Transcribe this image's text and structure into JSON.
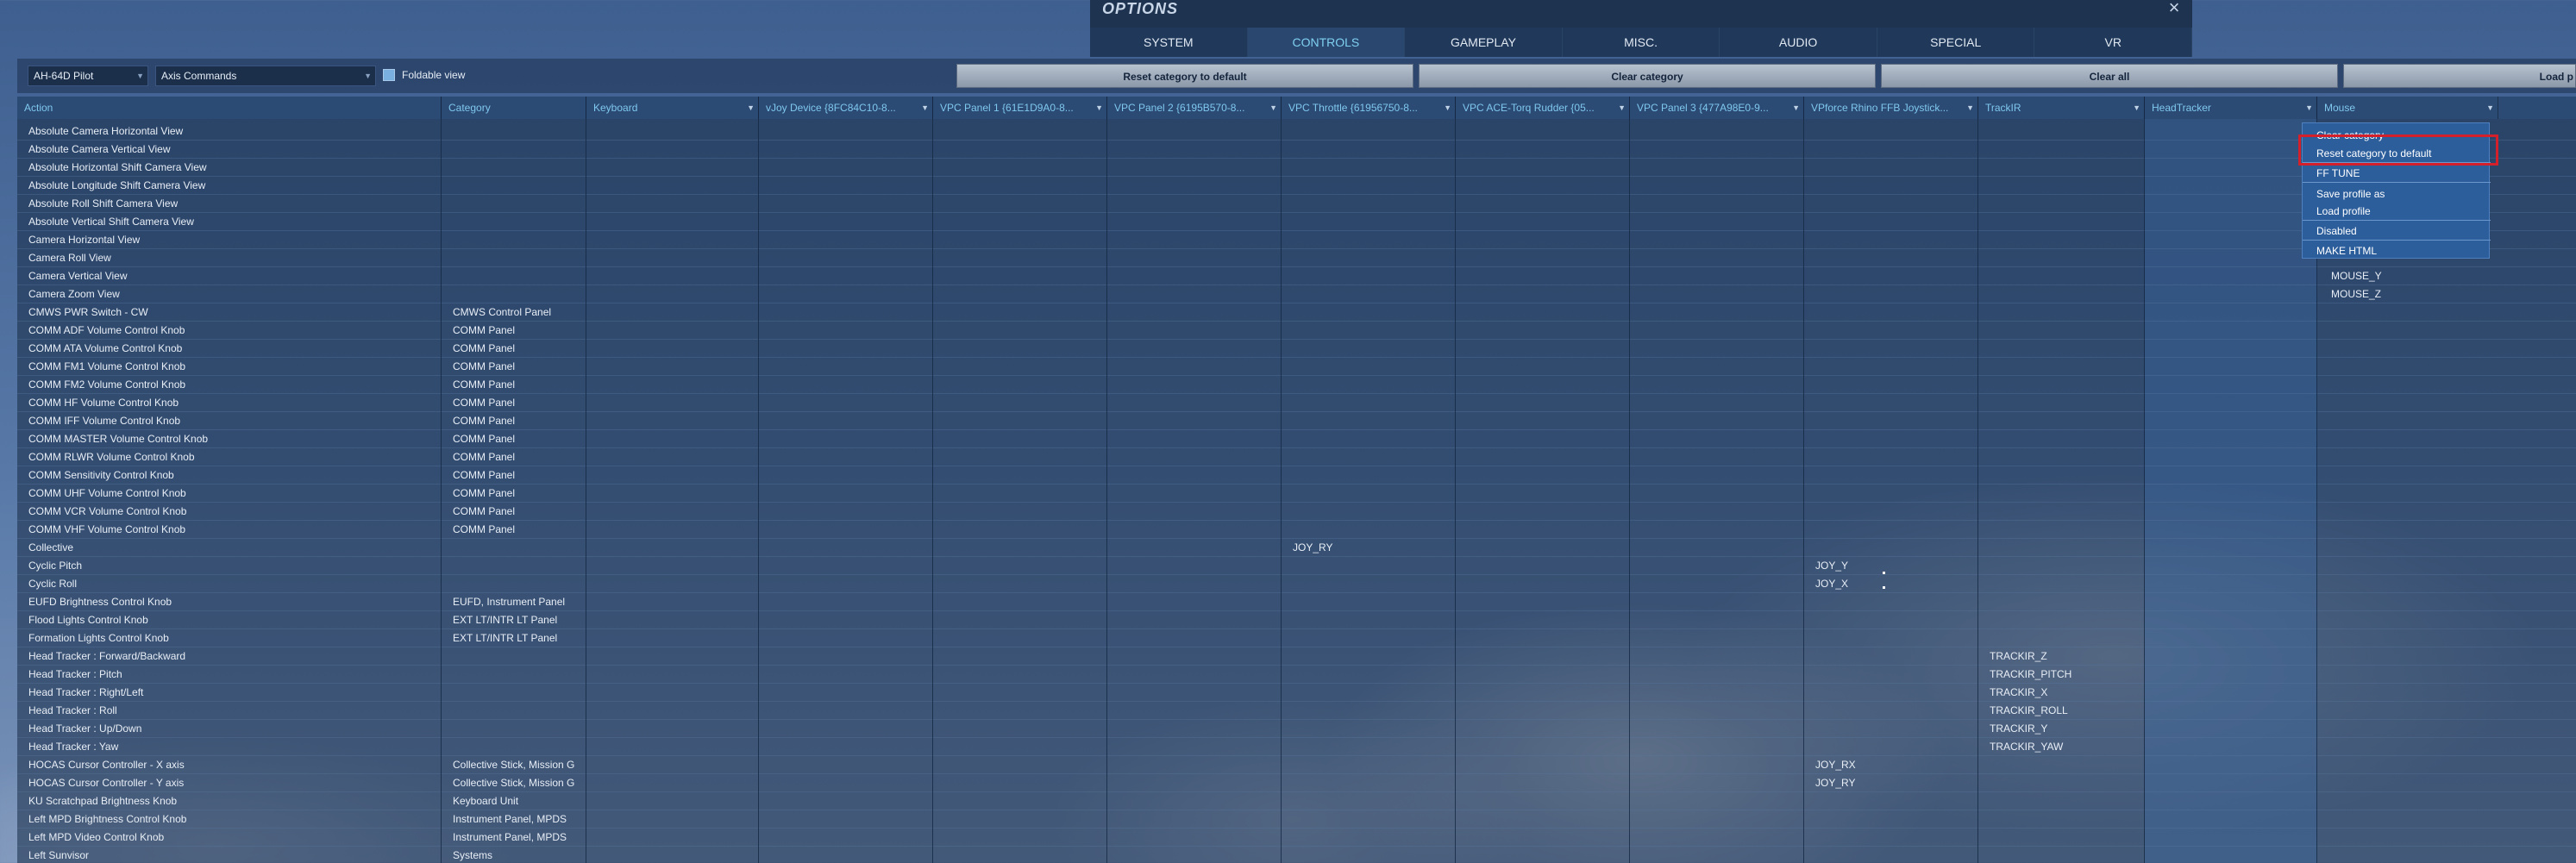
{
  "window": {
    "title": "OPTIONS",
    "close_icon": "close-icon"
  },
  "tabs": [
    {
      "label": "SYSTEM",
      "active": false
    },
    {
      "label": "CONTROLS",
      "active": true
    },
    {
      "label": "GAMEPLAY",
      "active": false
    },
    {
      "label": "MISC.",
      "active": false
    },
    {
      "label": "AUDIO",
      "active": false
    },
    {
      "label": "SPECIAL",
      "active": false
    },
    {
      "label": "VR",
      "active": false
    }
  ],
  "toolbar": {
    "aircraft": "AH-64D Pilot",
    "category": "Axis Commands",
    "foldable_label": "Foldable view",
    "foldable_checked": true,
    "reset_category": "Reset category to default",
    "clear_category": "Clear category",
    "clear_all": "Clear all",
    "load_profile": "Load p"
  },
  "columns": [
    "Action",
    "Category",
    "Keyboard",
    "vJoy Device {8FC84C10-8...",
    "VPC Panel 1 {61E1D9A0-8...",
    "VPC Panel 2 {6195B570-8...",
    "VPC Throttle {61956750-8...",
    "VPC ACE-Torq Rudder {05...",
    "VPC Panel 3 {477A98E0-9...",
    "VPforce Rhino FFB Joystick...",
    "TrackIR",
    "HeadTracker",
    "Mouse"
  ],
  "rows": [
    {
      "action": "Absolute Camera Horizontal View",
      "category": ""
    },
    {
      "action": "Absolute Camera Vertical View",
      "category": ""
    },
    {
      "action": "Absolute Horizontal Shift Camera View",
      "category": ""
    },
    {
      "action": "Absolute Longitude Shift Camera View",
      "category": ""
    },
    {
      "action": "Absolute Roll Shift Camera View",
      "category": ""
    },
    {
      "action": "Absolute Vertical Shift Camera View",
      "category": ""
    },
    {
      "action": "Camera Horizontal View",
      "category": ""
    },
    {
      "action": "Camera Roll View",
      "category": ""
    },
    {
      "action": "Camera Vertical View",
      "category": "",
      "mouse": "MOUSE_Y"
    },
    {
      "action": "Camera Zoom View",
      "category": "",
      "mouse": "MOUSE_Z"
    },
    {
      "action": "CMWS PWR Switch - CW",
      "category": "CMWS Control Panel"
    },
    {
      "action": "COMM ADF Volume Control Knob",
      "category": "COMM Panel"
    },
    {
      "action": "COMM ATA Volume Control Knob",
      "category": "COMM Panel"
    },
    {
      "action": "COMM FM1 Volume Control Knob",
      "category": "COMM Panel"
    },
    {
      "action": "COMM FM2 Volume Control Knob",
      "category": "COMM Panel"
    },
    {
      "action": "COMM HF Volume Control Knob",
      "category": "COMM Panel"
    },
    {
      "action": "COMM IFF Volume Control Knob",
      "category": "COMM Panel"
    },
    {
      "action": "COMM MASTER Volume Control Knob",
      "category": "COMM Panel"
    },
    {
      "action": "COMM RLWR Volume Control Knob",
      "category": "COMM Panel"
    },
    {
      "action": "COMM Sensitivity Control Knob",
      "category": "COMM Panel"
    },
    {
      "action": "COMM UHF Volume Control Knob",
      "category": "COMM Panel"
    },
    {
      "action": "COMM VCR Volume Control Knob",
      "category": "COMM Panel"
    },
    {
      "action": "COMM VHF Volume Control Knob",
      "category": "COMM Panel"
    },
    {
      "action": "Collective",
      "category": "",
      "vpc_throttle": "JOY_RY"
    },
    {
      "action": "Cyclic Pitch",
      "category": "",
      "vpforce": "JOY_Y"
    },
    {
      "action": "Cyclic Roll",
      "category": "",
      "vpforce": "JOY_X"
    },
    {
      "action": "EUFD Brightness Control Knob",
      "category": "EUFD, Instrument Panel"
    },
    {
      "action": "Flood Lights Control Knob",
      "category": "EXT LT/INTR LT Panel"
    },
    {
      "action": "Formation Lights Control Knob",
      "category": "EXT LT/INTR LT Panel"
    },
    {
      "action": "Head Tracker : Forward/Backward",
      "category": "",
      "trackir": "TRACKIR_Z"
    },
    {
      "action": "Head Tracker : Pitch",
      "category": "",
      "trackir": "TRACKIR_PITCH"
    },
    {
      "action": "Head Tracker : Right/Left",
      "category": "",
      "trackir": "TRACKIR_X"
    },
    {
      "action": "Head Tracker : Roll",
      "category": "",
      "trackir": "TRACKIR_ROLL"
    },
    {
      "action": "Head Tracker : Up/Down",
      "category": "",
      "trackir": "TRACKIR_Y"
    },
    {
      "action": "Head Tracker : Yaw",
      "category": "",
      "trackir": "TRACKIR_YAW"
    },
    {
      "action": "HOCAS Cursor Controller - X axis",
      "category": "Collective Stick, Mission G",
      "vpforce": "JOY_RX"
    },
    {
      "action": "HOCAS Cursor Controller - Y axis",
      "category": "Collective Stick, Mission G",
      "vpforce": "JOY_RY"
    },
    {
      "action": "KU Scratchpad Brightness Knob",
      "category": "Keyboard Unit"
    },
    {
      "action": "Left MPD Brightness Control Knob",
      "category": "Instrument Panel, MPDS"
    },
    {
      "action": "Left MPD Video Control Knob",
      "category": "Instrument Panel, MPDS"
    },
    {
      "action": "Left Sunvisor",
      "category": "Systems"
    }
  ],
  "context_menu": {
    "items": [
      "Clear category",
      "Reset category to default",
      "FF TUNE",
      "Save profile as",
      "Load profile",
      "Disabled",
      "MAKE HTML"
    ],
    "highlighted": "Reset category to default",
    "highlight_color": "#d3202a"
  }
}
